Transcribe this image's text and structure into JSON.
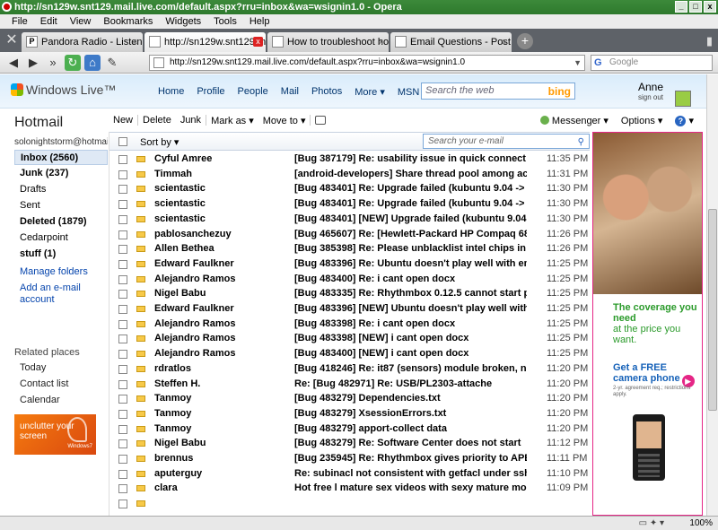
{
  "window": {
    "title": "http://sn129w.snt129.mail.live.com/default.aspx?rru=inbox&wa=wsignin1.0 - Opera",
    "minimize": "_",
    "maximize": "□",
    "close": "x"
  },
  "menu": [
    "File",
    "Edit",
    "View",
    "Bookmarks",
    "Widgets",
    "Tools",
    "Help"
  ],
  "tabs": [
    {
      "label": "Pandora Radio - Listen to ...",
      "icon": "P",
      "active": false
    },
    {
      "label": "http://sn129w.snt129.ma...",
      "icon": "",
      "active": true
    },
    {
      "label": "How to troubleshoot hot...",
      "icon": "",
      "active": false
    },
    {
      "label": "Email Questions - Post N...",
      "icon": "",
      "active": false
    }
  ],
  "address": {
    "url": "http://sn129w.snt129.mail.live.com/default.aspx?rru=inbox&wa=wsignin1.0",
    "search_placeholder": "Google"
  },
  "wl": {
    "logo": "Windows Live™",
    "nav": [
      "Home",
      "Profile",
      "People",
      "Mail",
      "Photos",
      "More ▾",
      "MSN ▾"
    ],
    "search_placeholder": "Search the web",
    "bing": "bing",
    "user": "Anne",
    "signout": "sign out"
  },
  "left": {
    "title": "Hotmail",
    "email": "solonightstorm@hotmai",
    "folders": [
      {
        "label": "Inbox (2560)",
        "bold": true,
        "selected": true
      },
      {
        "label": "Junk (237)",
        "bold": true,
        "selected": false
      },
      {
        "label": "Drafts",
        "bold": false,
        "selected": false
      },
      {
        "label": "Sent",
        "bold": false,
        "selected": false
      },
      {
        "label": "Deleted (1879)",
        "bold": true,
        "selected": false
      },
      {
        "label": "Cedarpoint",
        "bold": false,
        "selected": false
      },
      {
        "label": "stuff (1)",
        "bold": true,
        "selected": false
      }
    ],
    "manage_folders": "Manage folders",
    "add_account": "Add an e-mail account",
    "related_title": "Related places",
    "related": [
      "Today",
      "Contact list",
      "Calendar"
    ],
    "ad_text": "unclutter your screen",
    "ad_brand": "Windows7"
  },
  "toolbar": {
    "new": "New",
    "delete": "Delete",
    "junk": "Junk",
    "mark_as": "Mark as ▾",
    "move_to": "Move to ▾",
    "messenger": "Messenger ▾",
    "options": "Options ▾",
    "help": "?"
  },
  "list": {
    "sort_by": "Sort by ▾",
    "search_placeholder": "Search your e-mail",
    "rows": [
      {
        "sender": "Cyful Amree",
        "subject": "[Bug 387179] Re: usability issue in quick connect",
        "time": "11:35 PM"
      },
      {
        "sender": "Timmah",
        "subject": "[android-developers] Share thread pool among activ",
        "time": "11:31 PM"
      },
      {
        "sender": "scientastic",
        "subject": "[Bug 483401] Re: Upgrade failed (kubuntu 9.04 -> 9",
        "time": "11:30 PM"
      },
      {
        "sender": "scientastic",
        "subject": "[Bug 483401] Re: Upgrade failed (kubuntu 9.04 -> 9",
        "time": "11:30 PM"
      },
      {
        "sender": "scientastic",
        "subject": "[Bug 483401] [NEW] Upgrade failed (kubuntu 9.04 ->",
        "time": "11:30 PM"
      },
      {
        "sender": "pablosanchezuy",
        "subject": "[Bug 465607] Re: [Hewlett-Packard HP Compaq 682",
        "time": "11:26 PM"
      },
      {
        "sender": "Allen Bethea",
        "subject": "[Bug 385398] Re: Please unblacklist intel chips in cor",
        "time": "11:26 PM"
      },
      {
        "sender": "Edward Faulkner",
        "subject": "[Bug 483396] Re: Ubuntu doesn't play well with ema",
        "time": "11:25 PM"
      },
      {
        "sender": "Alejandro Ramos",
        "subject": "[Bug 483400] Re: i cant open docx",
        "time": "11:25 PM"
      },
      {
        "sender": "Nigel Babu",
        "subject": "[Bug 483335] Re: Rhythmbox 0.12.5 cannot start pl",
        "time": "11:25 PM"
      },
      {
        "sender": "Edward Faulkner",
        "subject": "[Bug 483396] [NEW] Ubuntu doesn't play well with e",
        "time": "11:25 PM"
      },
      {
        "sender": "Alejandro Ramos",
        "subject": "[Bug 483398] Re: i cant open docx",
        "time": "11:25 PM"
      },
      {
        "sender": "Alejandro Ramos",
        "subject": "[Bug 483398] [NEW] i cant open docx",
        "time": "11:25 PM"
      },
      {
        "sender": "Alejandro Ramos",
        "subject": "[Bug 483400] [NEW] i cant open docx",
        "time": "11:25 PM"
      },
      {
        "sender": "rdratlos",
        "subject": "[Bug 418246] Re: it87 (sensors) module broken, nee",
        "time": "11:20 PM"
      },
      {
        "sender": "Steffen H.",
        "subject": "Re: [Bug 482971] Re: USB/PL2303-attache",
        "time": "11:20 PM"
      },
      {
        "sender": "Tanmoy",
        "subject": "[Bug 483279] Dependencies.txt",
        "time": "11:20 PM"
      },
      {
        "sender": "Tanmoy",
        "subject": "[Bug 483279] XsessionErrors.txt",
        "time": "11:20 PM"
      },
      {
        "sender": "Tanmoy",
        "subject": "[Bug 483279] apport-collect data",
        "time": "11:20 PM"
      },
      {
        "sender": "Nigel Babu",
        "subject": "[Bug 483279] Re: Software Center does not start",
        "time": "11:12 PM"
      },
      {
        "sender": "brennus",
        "subject": "[Bug 235945] Re: Rhythmbox gives priority to APEv",
        "time": "11:11 PM"
      },
      {
        "sender": "aputerguy",
        "subject": "Re: subinacl not consistent with getfacl under ssh lo",
        "time": "11:10 PM"
      },
      {
        "sender": "clara",
        "subject": "Hot free l mature sex videos with sexy mature mode",
        "time": "11:09 PM"
      },
      {
        "sender": "",
        "subject": "",
        "time": ""
      }
    ]
  },
  "ad": {
    "headline": "The coverage you need",
    "subline": "at the price you want.",
    "free": "Get a FREE camera phone",
    "fine": "2-yr. agreement req.; restrictions apply."
  },
  "status": {
    "zoom": "100%"
  }
}
